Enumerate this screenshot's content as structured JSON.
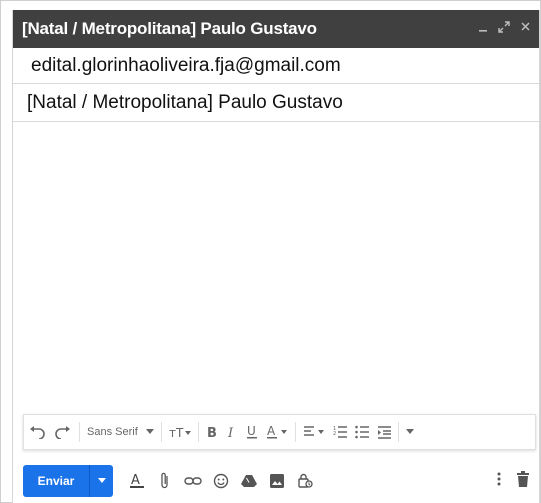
{
  "window": {
    "title": "[Natal / Metropolitana]  Paulo Gustavo",
    "minimize_icon": "minimize-icon",
    "expand_icon": "expand-icon",
    "close_icon": "close-icon"
  },
  "fields": {
    "to": "edital.glorinhaoliveira.fja@gmail.com",
    "subject": "[Natal / Metropolitana] Paulo Gustavo"
  },
  "format_toolbar": {
    "font": "Sans Serif"
  },
  "bottom_toolbar": {
    "send_label": "Enviar"
  },
  "colors": {
    "titlebar": "#404040",
    "send": "#1a73e8"
  }
}
